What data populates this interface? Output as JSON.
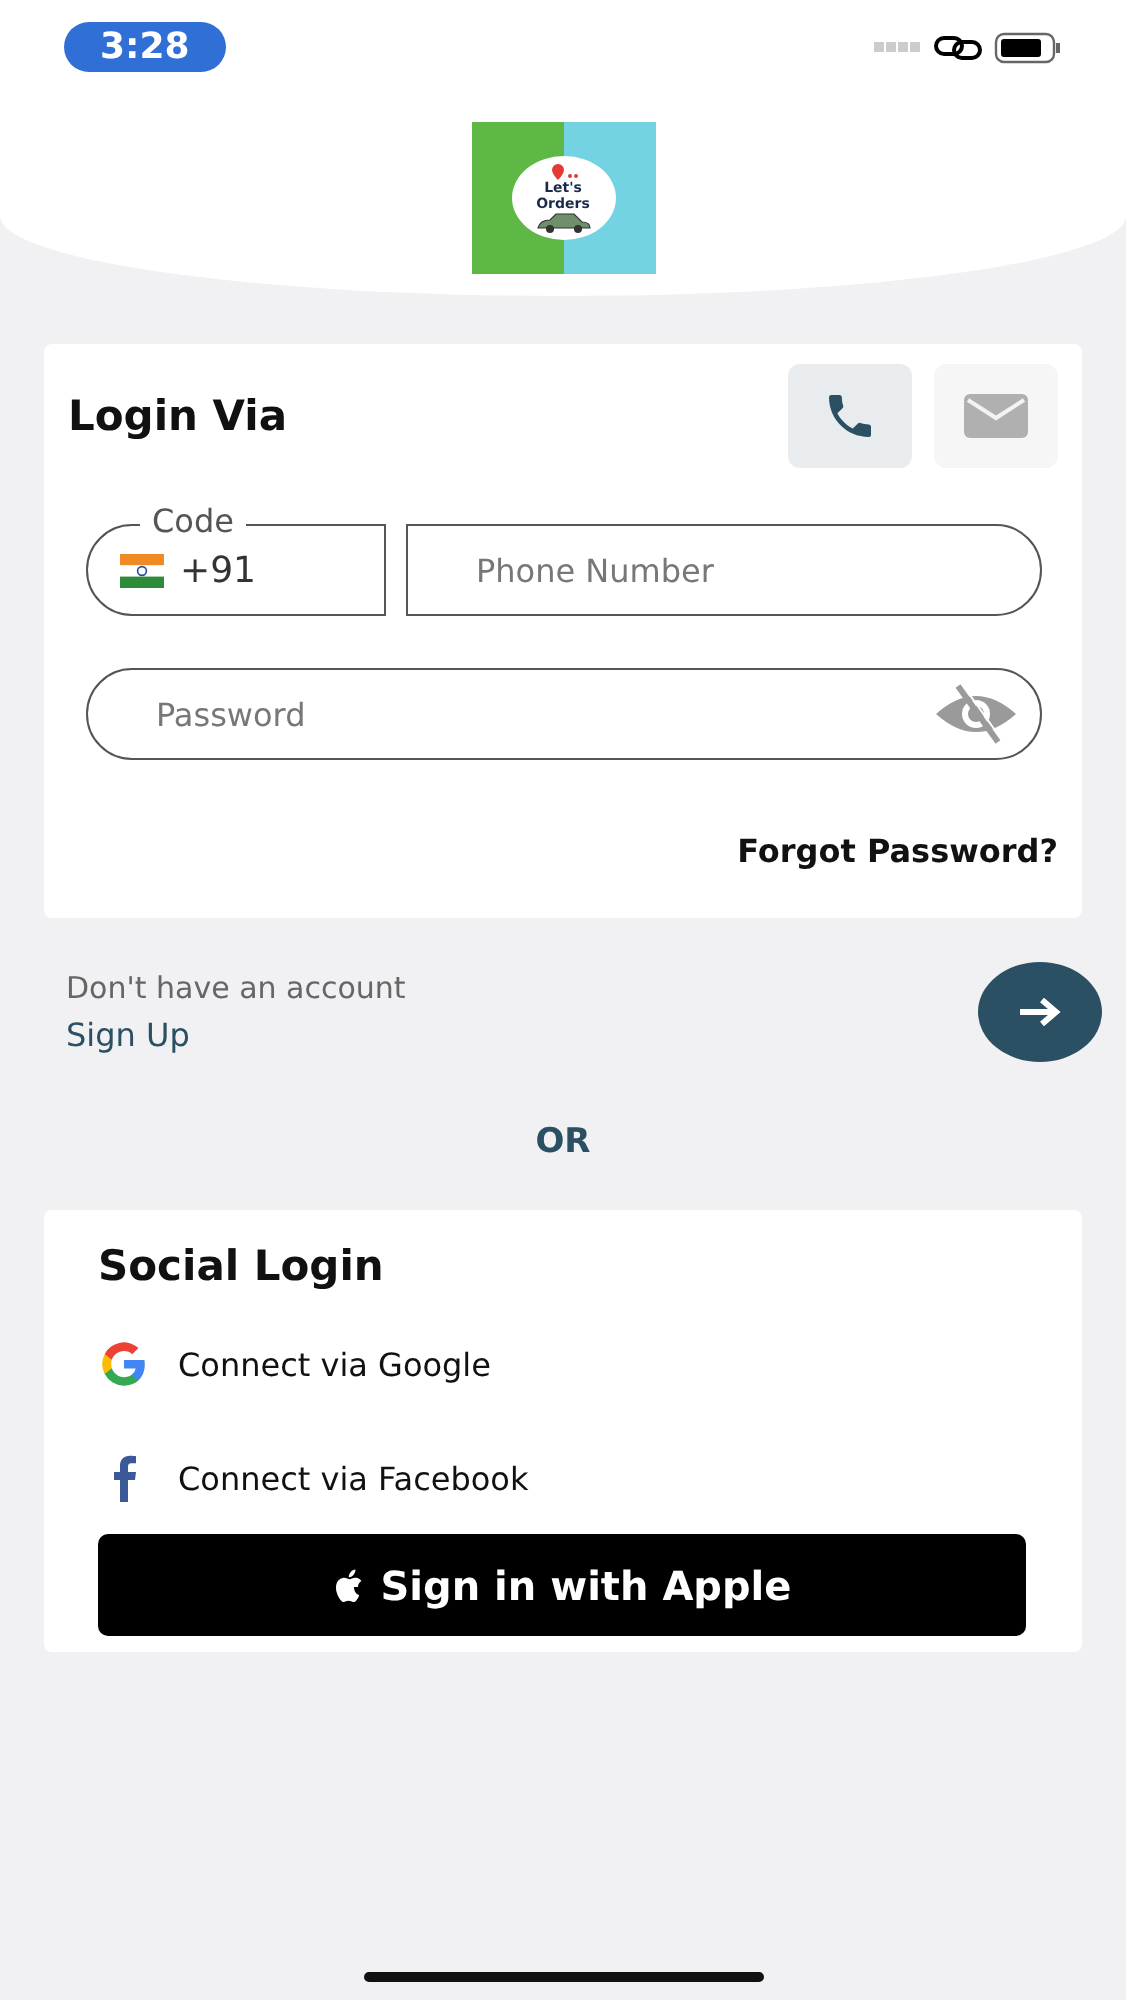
{
  "status_bar": {
    "time": "3:28"
  },
  "logo": {
    "line_1": "Let's",
    "line_2": "Orders"
  },
  "login": {
    "title": "Login Via",
    "methods": [
      {
        "kind": "phone",
        "selected": true
      },
      {
        "kind": "email",
        "selected": false
      }
    ],
    "code": {
      "label": "Code",
      "value": "+91"
    },
    "phone": {
      "placeholder": "Phone Number"
    },
    "password": {
      "placeholder": "Password"
    },
    "forgot": "Forgot Password?"
  },
  "signup": {
    "prompt": "Don't have an account",
    "link": "Sign Up"
  },
  "divider": "OR",
  "social": {
    "title": "Social Login",
    "items": [
      {
        "kind": "google",
        "label": "Connect via Google"
      },
      {
        "kind": "facebook",
        "label": "Connect via Facebook"
      }
    ],
    "apple": "Sign in with Apple"
  }
}
